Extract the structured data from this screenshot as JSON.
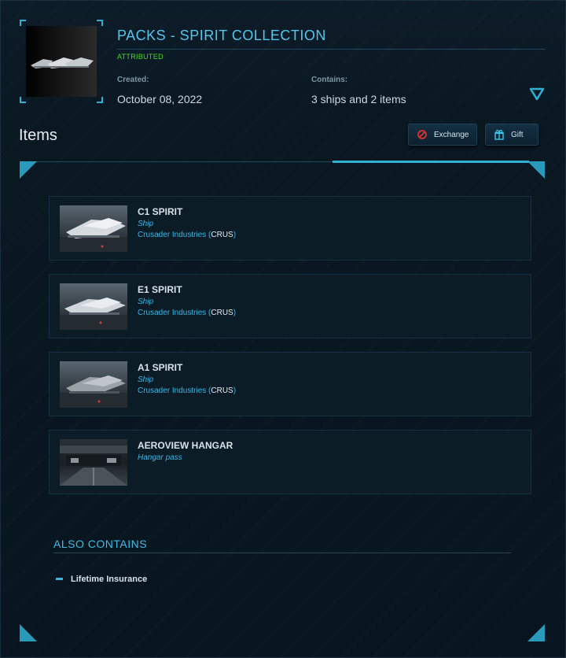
{
  "header": {
    "title": "PACKS - SPIRIT COLLECTION",
    "status": "ATTRIBUTED",
    "created_label": "Created:",
    "created_value": "October 08, 2022",
    "contains_label": "Contains:",
    "contains_value": "3 ships and 2 items",
    "expand_icon": "chevron-down-triangle-icon"
  },
  "items_section": {
    "title": "Items",
    "buttons": {
      "exchange_label": "Exchange",
      "exchange_icon": "exchange-icon",
      "gift_label": "Gift",
      "gift_icon": "gift-icon"
    }
  },
  "items": [
    {
      "name": "C1 SPIRIT",
      "type": "Ship",
      "manufacturer": "Crusader Industries",
      "code": "CRUS"
    },
    {
      "name": "E1 SPIRIT",
      "type": "Ship",
      "manufacturer": "Crusader Industries",
      "code": "CRUS"
    },
    {
      "name": "A1 SPIRIT",
      "type": "Ship",
      "manufacturer": "Crusader Industries",
      "code": "CRUS"
    },
    {
      "name": "AEROVIEW HANGAR",
      "type": "Hangar pass"
    }
  ],
  "also_contains": {
    "title": "ALSO CONTAINS",
    "items": [
      "Lifetime Insurance"
    ]
  },
  "colors": {
    "accent": "#2fb1d6",
    "title": "#52c6ec",
    "attributed": "#44dd1f",
    "link": "#37b6e3",
    "exchange_icon": "#e0332b"
  }
}
